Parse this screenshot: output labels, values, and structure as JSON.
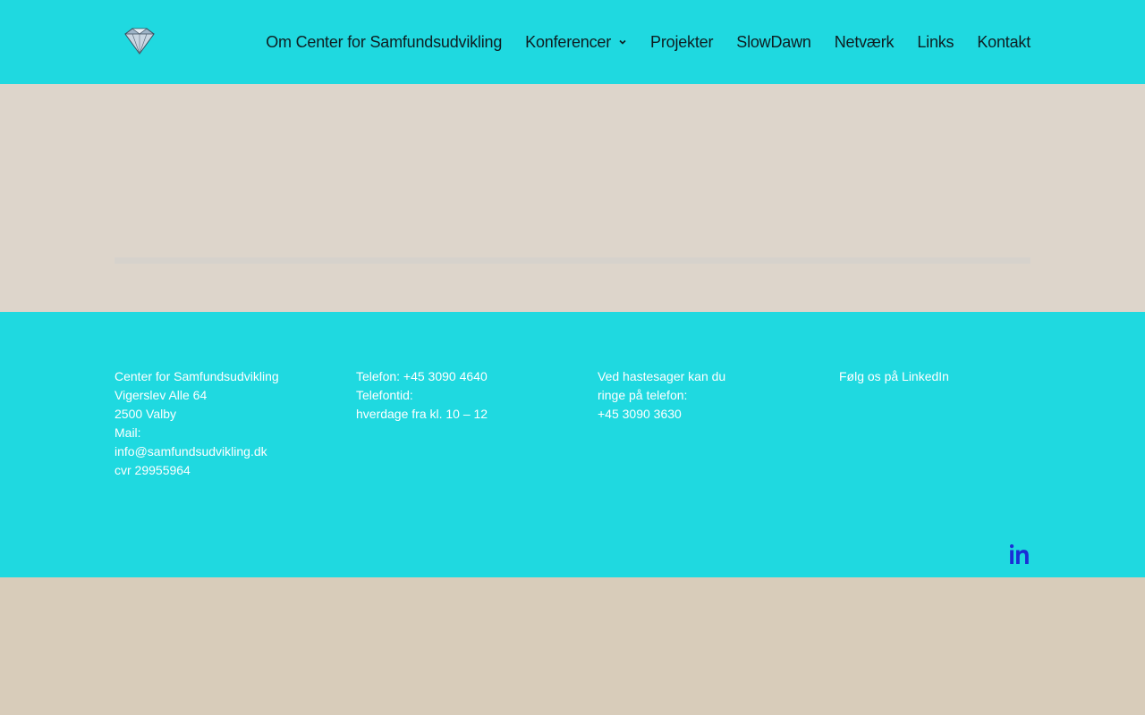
{
  "header": {
    "logo_icon": "diamond-icon",
    "nav": [
      {
        "label": "Om Center for Samfundsudvikling"
      },
      {
        "label": "Konferencer",
        "has_dropdown": true
      },
      {
        "label": "Projekter"
      },
      {
        "label": "SlowDawn"
      },
      {
        "label": "Netværk"
      },
      {
        "label": "Links"
      },
      {
        "label": "Kontakt"
      }
    ]
  },
  "footer": {
    "address": {
      "line1": "Center for Samfundsudvikling",
      "line2": "Vigerslev Alle 64",
      "line3": "2500 Valby",
      "line4": "Mail:",
      "email": "info@samfundsudvikling.dk",
      "cvr": "cvr 29955964"
    },
    "phone": {
      "line1": "Telefon: +45 3090 4640",
      "line2": "Telefontid:",
      "line3": "hverdage fra kl. 10 – 12"
    },
    "urgent": {
      "line1": "Ved hastesager kan du",
      "line2": "ringe på telefon:",
      "line3": "+45 3090 3630"
    },
    "social": {
      "label": "Følg os på LinkedIn",
      "icon": "linkedin-icon"
    }
  },
  "colors": {
    "header_bg": "#1fd9e0",
    "footer_bg": "#1fd9e0",
    "content_bg": "#ddd5cb",
    "page_bg": "#d8ccba",
    "nav_text": "#0e1e22",
    "footer_text": "#ffffff",
    "linkedin_icon": "#1a2fd6"
  }
}
